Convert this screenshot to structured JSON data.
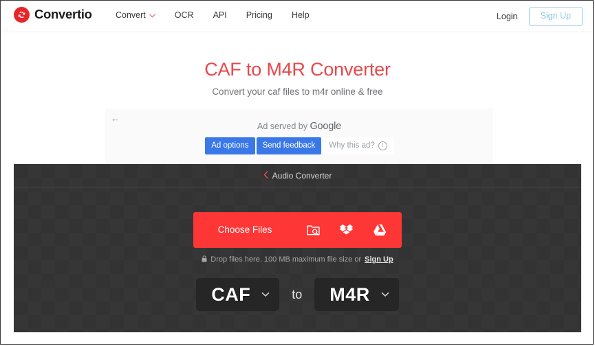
{
  "header": {
    "logo": {
      "icon": "convertio-circle-arrow-icon",
      "text": "Convertio",
      "color": "#e8262a"
    },
    "nav": [
      {
        "label": "Convert",
        "has_dropdown": true,
        "caret_icon": "chevron-down-icon"
      },
      {
        "label": "OCR",
        "has_dropdown": false
      },
      {
        "label": "API",
        "has_dropdown": false
      },
      {
        "label": "Pricing",
        "has_dropdown": false
      },
      {
        "label": "Help",
        "has_dropdown": false
      }
    ],
    "login_label": "Login",
    "signup_label": "Sign Up",
    "signup_border_color": "#a8d6e8",
    "signup_text_color": "#8cc9e0"
  },
  "hero": {
    "title": "CAF to M4R Converter",
    "title_color": "#e8484c",
    "subtitle": "Convert your caf files to m4r online & free"
  },
  "ad": {
    "back_icon": "arrow-left-icon",
    "served_by_prefix": "Ad served by",
    "served_by_brand": "Google",
    "buttons": [
      {
        "label": "Ad options",
        "style": "blue"
      },
      {
        "label": "Send feedback",
        "style": "blue"
      },
      {
        "label": "Why this ad?",
        "style": "light",
        "icon": "info-circle-icon"
      }
    ],
    "blue": "#3b78e7"
  },
  "converter": {
    "breadcrumb": {
      "chevron_icon": "chevron-left-icon",
      "label": "Audio Converter",
      "chevron_color": "#e8484c"
    },
    "choose_files": {
      "label": "Choose Files",
      "background": "#ff3636",
      "sources": [
        {
          "icon": "folder-search-icon",
          "name": "local-files"
        },
        {
          "icon": "dropbox-icon",
          "name": "dropbox"
        },
        {
          "icon": "google-drive-icon",
          "name": "google-drive"
        }
      ]
    },
    "drop_note": {
      "lock_icon": "lock-icon",
      "text": "Drop files here. 100 MB maximum file size or",
      "signup_label": "Sign Up"
    },
    "formats": {
      "source": {
        "value": "CAF",
        "caret_icon": "chevron-down-icon"
      },
      "connector": "to",
      "target": {
        "value": "M4R",
        "caret_icon": "chevron-down-icon"
      }
    }
  }
}
